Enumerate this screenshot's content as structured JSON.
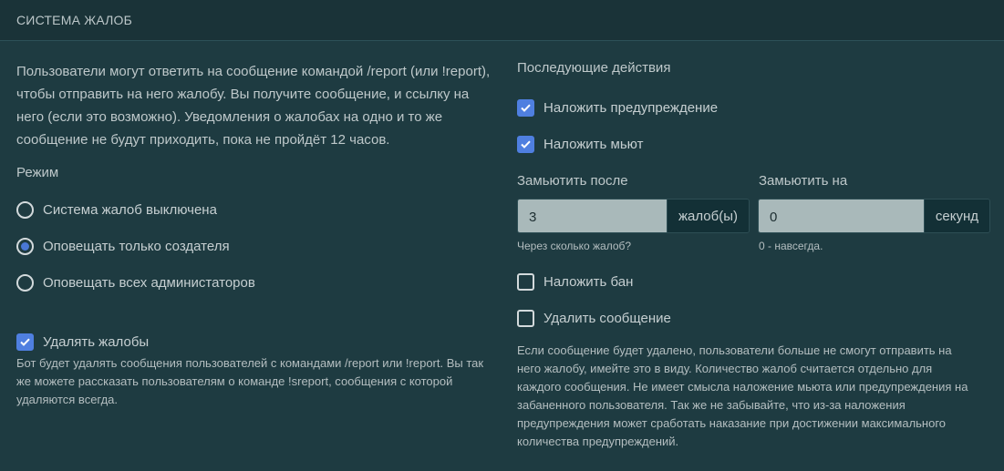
{
  "header": {
    "title": "СИСТЕМА ЖАЛОБ"
  },
  "intro": "Пользователи могут ответить на сообщение командой /report (или !report), чтобы отправить на него жалобу. Вы получите сообщение, и ссылку на него (если это возможно). Уведомления о жалобах на одно и то же сообщение не будут приходить, пока не пройдёт 12 часов.",
  "mode": {
    "label": "Режим",
    "options": [
      {
        "label": "Система жалоб выключена",
        "selected": false
      },
      {
        "label": "Оповещать только создателя",
        "selected": true
      },
      {
        "label": "Оповещать всех администаторов",
        "selected": false
      }
    ]
  },
  "delete_reports": {
    "label": "Удалять жалобы",
    "checked": true,
    "description": "Бот будет удалять сообщения пользователей с командами /report или !report. Вы так же можете рассказать пользователям о команде !sreport, сообщения с которой удаляются всегда."
  },
  "actions": {
    "label": "Последующие действия",
    "warn": {
      "label": "Наложить предупреждение",
      "checked": true
    },
    "mute": {
      "label": "Наложить мьют",
      "checked": true
    },
    "mute_after": {
      "label": "Замьютить после",
      "value": "3",
      "unit": "жалоб(ы)",
      "hint": "Через сколько жалоб?"
    },
    "mute_for": {
      "label": "Замьютить на",
      "value": "0",
      "unit": "секунд",
      "hint": "0 - навсегда."
    },
    "ban": {
      "label": "Наложить бан",
      "checked": false
    },
    "delete_message": {
      "label": "Удалить сообщение",
      "checked": false
    },
    "note": "Если сообщение будет удалено, пользователи больше не смогут отправить на него жалобу, имейте это в виду. Количество жалоб считается отдельно для каждого сообщения. Не имеет смысла наложение мьюта или предупреждения на забаненного пользователя. Так же не забывайте, что из-за наложения предупреждения может сработать наказание при достижении максимального количества предупреждений."
  },
  "colors": {
    "background": "#1e3b41",
    "header": "#1a3338",
    "accent": "#4f7fe0",
    "input": "#a9b9ba"
  }
}
